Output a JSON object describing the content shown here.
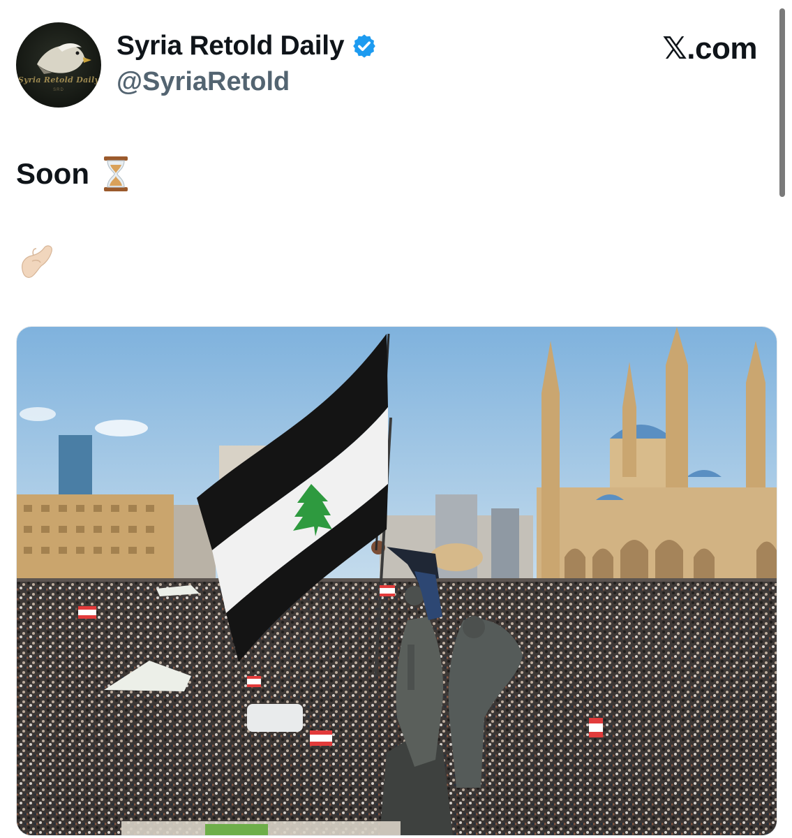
{
  "header": {
    "display_name": "Syria Retold Daily",
    "handle": "@SyriaRetold",
    "site_label": "𝕏.com",
    "avatar": {
      "script_text": "Syria Retold Daily",
      "sub_text": "SRD"
    }
  },
  "tweet": {
    "text": "Soon",
    "emoji_1": "hourglass-icon",
    "emoji_2": "pinching-hand-icon"
  },
  "media": {
    "flag_icon": "cedar-flag",
    "colors": {
      "flag_black": "#141414",
      "flag_white": "#f1f1f1",
      "cedar_green": "#2e9a3f",
      "sky": "#9fc6e4",
      "mosque_stone": "#d2b383",
      "dome_blue": "#5a8fc2",
      "verified_blue": "#1d9bf0"
    }
  }
}
